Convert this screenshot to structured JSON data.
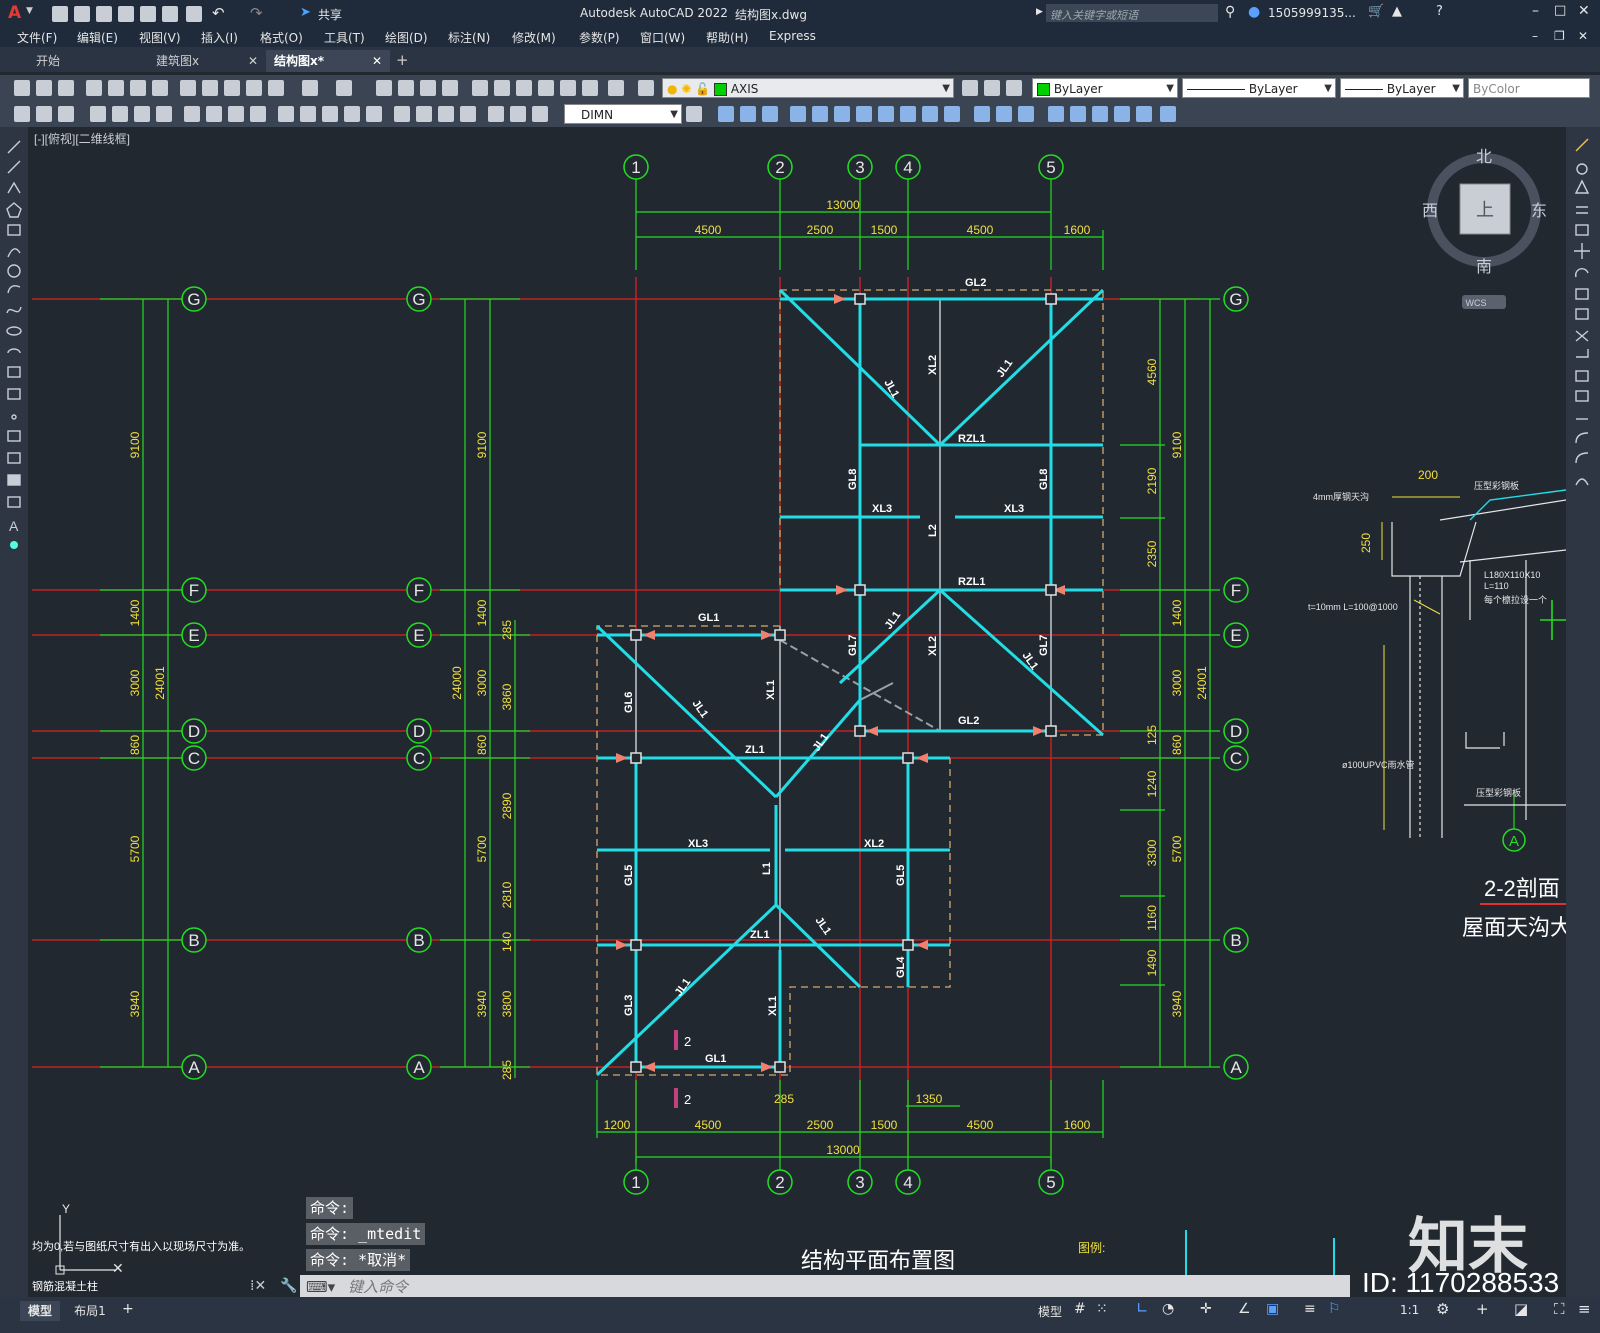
{
  "app": {
    "title": "Autodesk AutoCAD 2022",
    "file": "结构图x.dwg",
    "search_placeholder": "键入关键字或短语",
    "user": "1505999135...",
    "share": "共享"
  },
  "menu": [
    "文件(F)",
    "编辑(E)",
    "视图(V)",
    "插入(I)",
    "格式(O)",
    "工具(T)",
    "绘图(D)",
    "标注(N)",
    "修改(M)",
    "参数(P)",
    "窗口(W)",
    "帮助(H)",
    "Express"
  ],
  "tabs": [
    {
      "label": "开始"
    },
    {
      "label": "建筑图x"
    },
    {
      "label": "结构图x*"
    }
  ],
  "toolbar": {
    "layer_value": "AXIS",
    "color_value": "ByLayer",
    "linetype_value": "ByLayer",
    "lineweight_value": "ByLayer",
    "plotstyle_value": "ByColor",
    "dimstyle_value": "DIMN"
  },
  "viewport_label": "[-][俯视][二维线框]",
  "viewcube": {
    "north": "北",
    "south": "南",
    "east": "东",
    "west": "西",
    "top": "上",
    "wcs": "WCS"
  },
  "drawing": {
    "title": "结构平面布置图",
    "section_title": "2-2剖面",
    "section_subtitle": "屋面天沟大",
    "legend_label": "图例:",
    "note_line1": "均为0,若与图纸尺寸有出入以现场尺寸为准。",
    "note_line2": "钢筋混凝土柱",
    "axes_numbers": [
      "1",
      "2",
      "3",
      "4",
      "5"
    ],
    "axes_letters": [
      "G",
      "F",
      "E",
      "D",
      "C",
      "B",
      "A"
    ],
    "top_total": "13000",
    "top_dims": [
      "4500",
      "2500",
      "1500",
      "4500",
      "1600"
    ],
    "bottom_dims": [
      "1200",
      "4500",
      "2500",
      "1500",
      "4500",
      "1600"
    ],
    "bottom_total": "13000",
    "bottom_extra": [
      "285",
      "1350"
    ],
    "left_dims": [
      "9100",
      "1400",
      "3000",
      "860",
      "5700",
      "3940"
    ],
    "left_total": "24001",
    "left2_total": "24000",
    "left2_dims": [
      "9100",
      "1400",
      "3000",
      "860",
      "5700",
      "3940"
    ],
    "left2_inner": [
      "285",
      "3860",
      "2890",
      "2810",
      "140",
      "3800",
      "285"
    ],
    "right_dims": [
      "4560",
      "2190",
      "2350",
      "125",
      "1240",
      "3300",
      "1160",
      "1490"
    ],
    "right_outer": [
      "9100",
      "1400",
      "3000",
      "860",
      "5700",
      "3940"
    ],
    "right_total": "24001",
    "beams": [
      "GL2",
      "XL2",
      "JL1",
      "RZL1",
      "GL8",
      "XL3",
      "L2",
      "GL1",
      "GL6",
      "JL1",
      "XL1",
      "GL7",
      "XL2",
      "GL2",
      "ZL1",
      "XL3",
      "XL2",
      "L1",
      "GL5",
      "ZL1",
      "GL4",
      "GL3",
      "XL1",
      "GL1"
    ],
    "marker_2": "2",
    "section_notes": [
      "4mm厚钢天沟",
      "压型彩钢板",
      "L180X110X10",
      "L=110",
      "每个檩拉设一个",
      "t=10mm L=100@1000",
      "ø100UPVC雨水管",
      "压型彩钢板"
    ],
    "section_dims": [
      "200",
      "250"
    ],
    "section_axis": "A"
  },
  "command": {
    "history": [
      "命令:",
      "命令: _mtedit",
      "命令: *取消*"
    ],
    "placeholder": "键入命令"
  },
  "layout_tabs": [
    "模型",
    "布局1"
  ],
  "status": {
    "model": "模型",
    "scale": "1:1"
  },
  "watermark": {
    "brand": "知末",
    "id": "ID: 1170288533"
  }
}
